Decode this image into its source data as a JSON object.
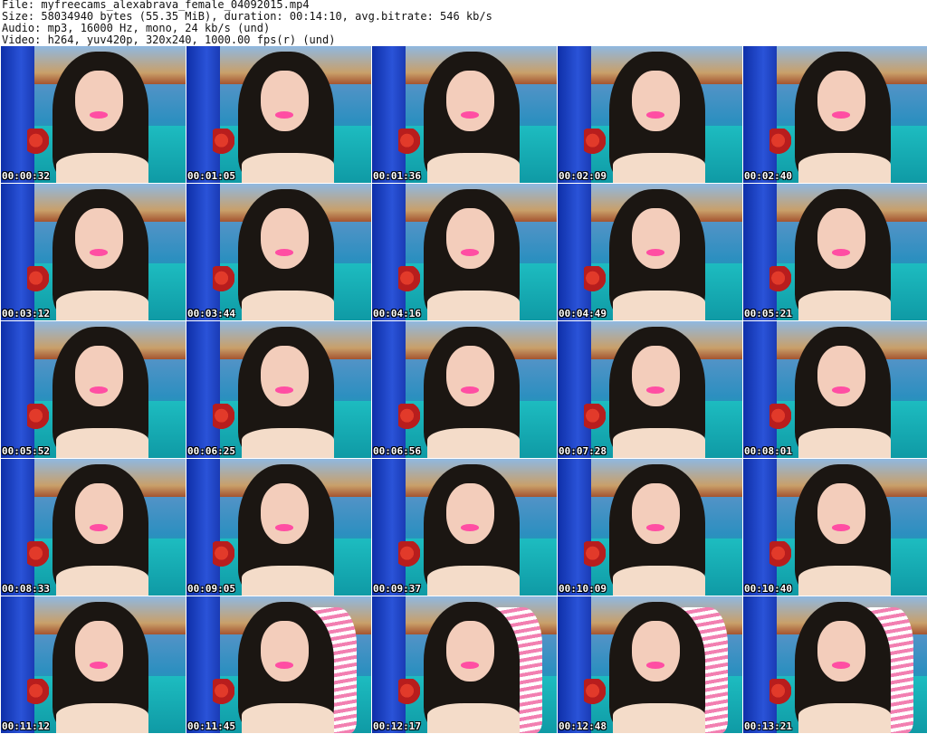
{
  "header": {
    "file_line": "File: myfreecams_alexabrava_female_04092015.mp4",
    "size_line": "Size: 58034940 bytes (55.35 MiB), duration: 00:14:10, avg.bitrate: 546 kb/s",
    "audio_line": "Audio: mp3, 16000 Hz, mono, 24 kb/s (und)",
    "video_line": "Video: h264, yuv420p, 320x240, 1000.00 fps(r) (und)"
  },
  "thumbnails": [
    {
      "time": "00:00:32"
    },
    {
      "time": "00:01:05"
    },
    {
      "time": "00:01:36"
    },
    {
      "time": "00:02:09"
    },
    {
      "time": "00:02:40"
    },
    {
      "time": "00:03:12"
    },
    {
      "time": "00:03:44"
    },
    {
      "time": "00:04:16"
    },
    {
      "time": "00:04:49"
    },
    {
      "time": "00:05:21"
    },
    {
      "time": "00:05:52"
    },
    {
      "time": "00:06:25"
    },
    {
      "time": "00:06:56"
    },
    {
      "time": "00:07:28"
    },
    {
      "time": "00:08:01"
    },
    {
      "time": "00:08:33"
    },
    {
      "time": "00:09:05"
    },
    {
      "time": "00:09:37"
    },
    {
      "time": "00:10:09"
    },
    {
      "time": "00:10:40"
    },
    {
      "time": "00:11:12"
    },
    {
      "time": "00:11:45",
      "friend": true
    },
    {
      "time": "00:12:17",
      "friend": true
    },
    {
      "time": "00:12:48",
      "friend": true
    },
    {
      "time": "00:13:21",
      "friend": true
    }
  ]
}
